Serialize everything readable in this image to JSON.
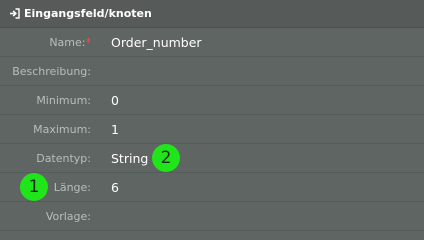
{
  "header": {
    "title": "Eingangsfeld/knoten",
    "icon": "sign-in-icon"
  },
  "fields": [
    {
      "label": "Name:",
      "required_mark": "*",
      "value": "Order_number"
    },
    {
      "label": "Beschreibung:",
      "value": ""
    },
    {
      "label": "Minimum:",
      "value": "0"
    },
    {
      "label": "Maximum:",
      "value": "1"
    },
    {
      "label": "Datentyp:",
      "value": "String"
    },
    {
      "label": "Länge:",
      "value": "6"
    },
    {
      "label": "Vorlage:",
      "value": ""
    }
  ],
  "markers": [
    {
      "text": "1"
    },
    {
      "text": "2"
    }
  ],
  "colors": {
    "background": "#5f6563",
    "label": "#b9bebd",
    "value": "#ffffff",
    "required": "#ff4d3d",
    "marker": "#1fe51a"
  }
}
